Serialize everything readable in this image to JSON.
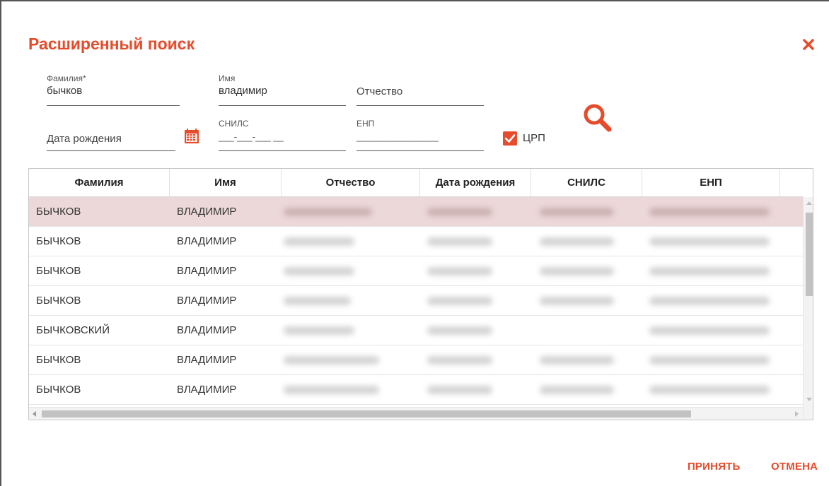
{
  "dialog": {
    "title": "Расширенный поиск"
  },
  "form": {
    "surname": {
      "label": "Фамилия*",
      "value": "бычков"
    },
    "name": {
      "label": "Имя",
      "value": "владимир"
    },
    "patronymic": {
      "placeholder": "Отчество"
    },
    "birthdate": {
      "placeholder": "Дата рождения"
    },
    "snils": {
      "label": "СНИЛС",
      "mask": "___-___-___ __"
    },
    "enp": {
      "label": "ЕНП",
      "mask": "________________"
    },
    "crp": {
      "label": "ЦРП",
      "checked": true
    }
  },
  "grid": {
    "columns": [
      "Фамилия",
      "Имя",
      "Отчество",
      "Дата рождения",
      "СНИЛС",
      "ЕНП"
    ],
    "rows": [
      {
        "surname": "БЫЧКОВ",
        "name": "ВЛАДИМИР",
        "selected": true
      },
      {
        "surname": "БЫЧКОВ",
        "name": "ВЛАДИМИР"
      },
      {
        "surname": "БЫЧКОВ",
        "name": "ВЛАДИМИР"
      },
      {
        "surname": "БЫЧКОВ",
        "name": "ВЛАДИМИР"
      },
      {
        "surname": "БЫЧКОВСКИЙ",
        "name": "ВЛАДИМИР"
      },
      {
        "surname": "БЫЧКОВ",
        "name": "ВЛАДИМИР"
      },
      {
        "surname": "БЫЧКОВ",
        "name": "ВЛАДИМИР"
      }
    ]
  },
  "footer": {
    "accept": "ПРИНЯТЬ",
    "cancel": "ОТМЕНА"
  },
  "colors": {
    "accent": "#e64b2b",
    "selected_row": "#ecd8d8"
  },
  "icons": [
    "close-icon",
    "calendar-icon",
    "checkbox-checked-icon",
    "search-icon"
  ]
}
